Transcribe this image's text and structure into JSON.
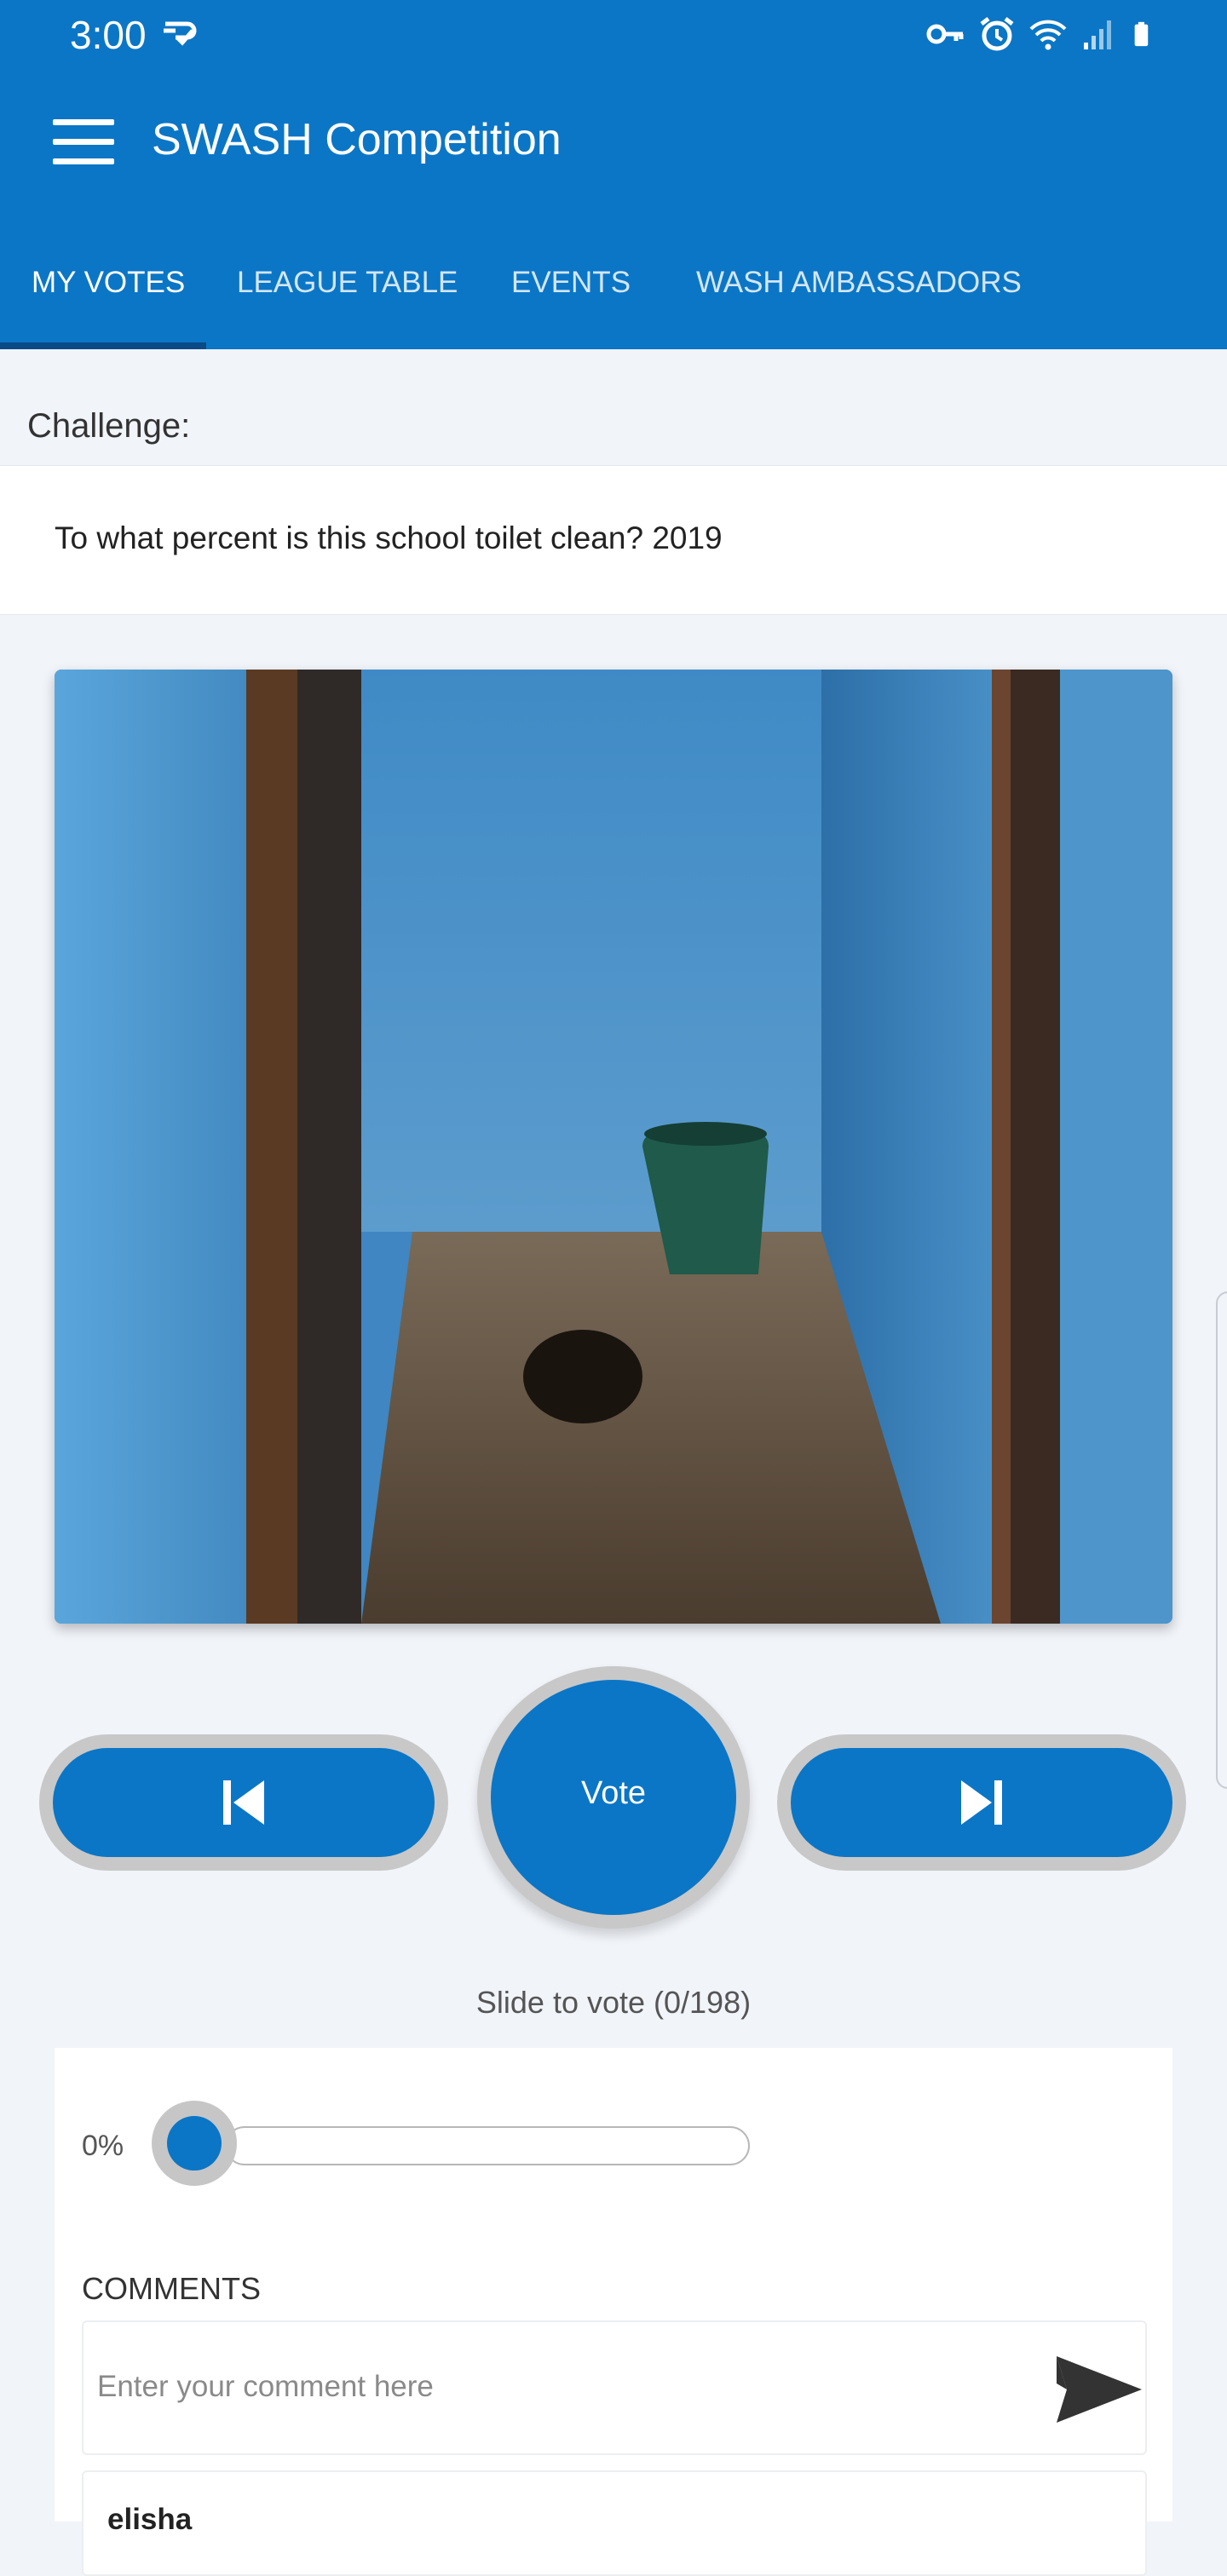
{
  "status_bar": {
    "time": "3:00"
  },
  "app": {
    "title": "SWASH Competition",
    "accent_color": "#0b76c6"
  },
  "tabs": [
    {
      "label": "MY VOTES",
      "active": true
    },
    {
      "label": "LEAGUE TABLE",
      "active": false
    },
    {
      "label": "EVENTS",
      "active": false
    },
    {
      "label": "WASH AMBASSADORS",
      "active": false
    }
  ],
  "challenge": {
    "label": "Challenge:",
    "text": "To what percent is this school toilet clean? 2019"
  },
  "controls": {
    "vote_label": "Vote",
    "prev_icon": "skip-previous-icon",
    "next_icon": "skip-next-icon",
    "slide_hint": "Slide to vote (0/198)"
  },
  "vote": {
    "percent_label": "0%",
    "slider_value_percent": 0
  },
  "comments": {
    "heading": "COMMENTS",
    "placeholder": "Enter your comment here",
    "send_icon": "send-icon",
    "items": [
      {
        "author": "elisha"
      }
    ]
  }
}
